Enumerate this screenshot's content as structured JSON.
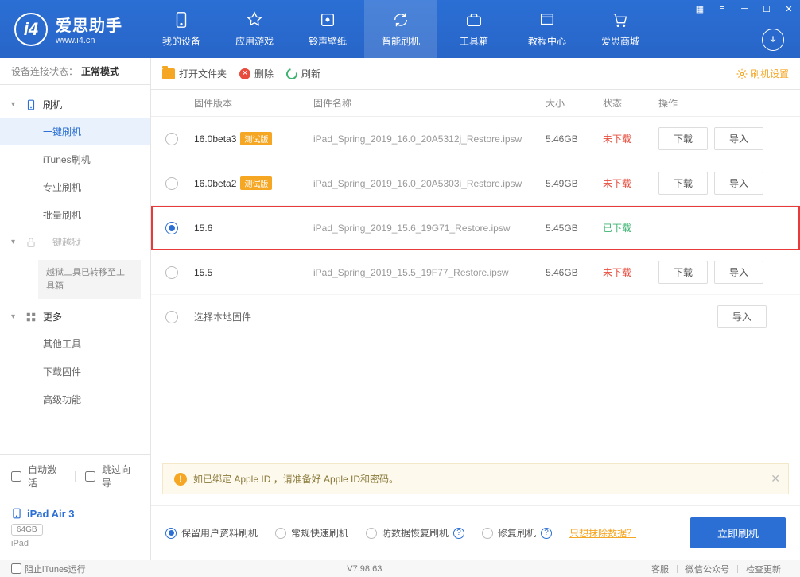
{
  "app": {
    "title": "爱思助手",
    "subtitle": "www.i4.cn"
  },
  "nav": [
    {
      "label": "我的设备",
      "icon": "device"
    },
    {
      "label": "应用游戏",
      "icon": "apps"
    },
    {
      "label": "铃声壁纸",
      "icon": "music"
    },
    {
      "label": "智能刷机",
      "icon": "refresh",
      "active": true
    },
    {
      "label": "工具箱",
      "icon": "toolbox"
    },
    {
      "label": "教程中心",
      "icon": "tutorial"
    },
    {
      "label": "爱思商城",
      "icon": "store"
    }
  ],
  "status": {
    "label": "设备连接状态：",
    "value": "正常模式"
  },
  "sidebar": {
    "flash": {
      "label": "刷机"
    },
    "items": [
      "一键刷机",
      "iTunes刷机",
      "专业刷机",
      "批量刷机"
    ],
    "active_index": 0,
    "jailbreak": {
      "label": "一键越狱",
      "notice": "越狱工具已转移至工具箱"
    },
    "more": {
      "label": "更多",
      "items": [
        "其他工具",
        "下载固件",
        "高级功能"
      ]
    },
    "auto_activate": "自动激活",
    "skip_wizard": "跳过向导",
    "device": {
      "name": "iPad Air 3",
      "capacity": "64GB",
      "type": "iPad"
    }
  },
  "toolbar": {
    "open": "打开文件夹",
    "delete": "删除",
    "refresh": "刷新",
    "settings": "刷机设置"
  },
  "table": {
    "headers": {
      "version": "固件版本",
      "name": "固件名称",
      "size": "大小",
      "status": "状态",
      "ops": "操作"
    },
    "rows": [
      {
        "version": "16.0beta3",
        "badge": "测试版",
        "name": "iPad_Spring_2019_16.0_20A5312j_Restore.ipsw",
        "size": "5.46GB",
        "status": "未下载",
        "selected": false,
        "downloaded": false
      },
      {
        "version": "16.0beta2",
        "badge": "测试版",
        "name": "iPad_Spring_2019_16.0_20A5303i_Restore.ipsw",
        "size": "5.49GB",
        "status": "未下载",
        "selected": false,
        "downloaded": false
      },
      {
        "version": "15.6",
        "badge": "",
        "name": "iPad_Spring_2019_15.6_19G71_Restore.ipsw",
        "size": "5.45GB",
        "status": "已下载",
        "selected": true,
        "downloaded": true,
        "highlight": true
      },
      {
        "version": "15.5",
        "badge": "",
        "name": "iPad_Spring_2019_15.5_19F77_Restore.ipsw",
        "size": "5.46GB",
        "status": "未下载",
        "selected": false,
        "downloaded": false
      }
    ],
    "local_row": "选择本地固件",
    "btn_download": "下载",
    "btn_import": "导入"
  },
  "info_bar": "如已绑定 Apple ID ，请准备好 Apple ID和密码。",
  "options": {
    "keep_data": "保留用户资料刷机",
    "normal": "常规快速刷机",
    "anti_recovery": "防数据恢复刷机",
    "repair": "修复刷机",
    "erase_link": "只想抹除数据？",
    "flash_now": "立即刷机"
  },
  "footer": {
    "block_itunes": "阻止iTunes运行",
    "version": "V7.98.63",
    "service": "客服",
    "wechat": "微信公众号",
    "update": "检查更新"
  }
}
